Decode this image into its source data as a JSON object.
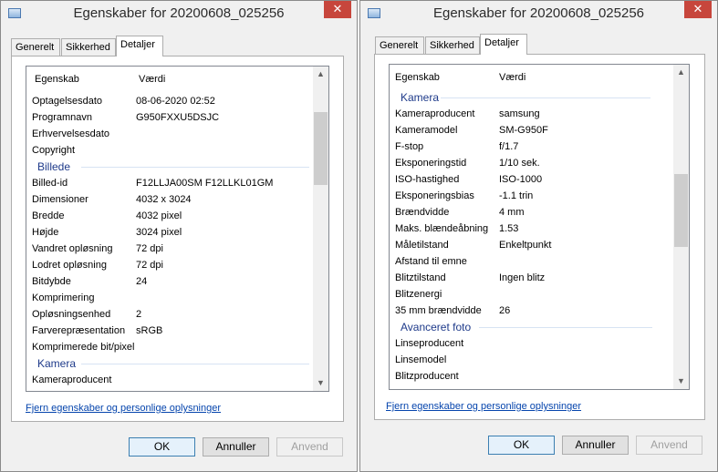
{
  "left_window": {
    "title": "Egenskaber for 20200608_025256",
    "close_glyph": "✕",
    "tabs": [
      {
        "label": "Generelt"
      },
      {
        "label": "Sikkerhed"
      },
      {
        "label": "Detaljer"
      }
    ],
    "columns": {
      "property": "Egenskab",
      "value": "Værdi"
    },
    "rows_before_group1": [
      {
        "k": "Optagelsesdato",
        "v": "08-06-2020 02:52"
      },
      {
        "k": "Programnavn",
        "v": "G950FXXU5DSJC"
      },
      {
        "k": "Erhvervelsesdato",
        "v": ""
      },
      {
        "k": "Copyright",
        "v": ""
      }
    ],
    "group1": "Billede",
    "group1_rows": [
      {
        "k": "Billed-id",
        "v": "F12LLJA00SM F12LLKL01GM"
      },
      {
        "k": "Dimensioner",
        "v": "4032 x 3024"
      },
      {
        "k": "Bredde",
        "v": "4032 pixel"
      },
      {
        "k": "Højde",
        "v": "3024 pixel"
      },
      {
        "k": "Vandret opløsning",
        "v": "72 dpi"
      },
      {
        "k": "Lodret opløsning",
        "v": "72 dpi"
      },
      {
        "k": "Bitdybde",
        "v": "24"
      },
      {
        "k": "Komprimering",
        "v": ""
      },
      {
        "k": "Opløsningsenhed",
        "v": "2"
      },
      {
        "k": "Farverepræsentation",
        "v": "sRGB"
      },
      {
        "k": "Komprimerede bit/pixel",
        "v": ""
      }
    ],
    "group2": "Kamera",
    "group2_rows": [
      {
        "k": "Kameraproducent",
        "v": ""
      }
    ],
    "link": "Fjern egenskaber og personlige oplysninger",
    "buttons": {
      "ok": "OK",
      "cancel": "Annuller",
      "apply": "Anvend"
    }
  },
  "right_window": {
    "title": "Egenskaber for 20200608_025256",
    "close_glyph": "✕",
    "tabs": [
      {
        "label": "Generelt"
      },
      {
        "label": "Sikkerhed"
      },
      {
        "label": "Detaljer"
      }
    ],
    "columns": {
      "property": "Egenskab",
      "value": "Værdi"
    },
    "group1": "Kamera",
    "group1_rows": [
      {
        "k": "Kameraproducent",
        "v": "samsung"
      },
      {
        "k": "Kameramodel",
        "v": "SM-G950F"
      },
      {
        "k": "F-stop",
        "v": "f/1.7"
      },
      {
        "k": "Eksponeringstid",
        "v": "1/10 sek."
      },
      {
        "k": "ISO-hastighed",
        "v": "ISO-1000"
      },
      {
        "k": "Eksponeringsbias",
        "v": "-1.1 trin"
      },
      {
        "k": "Brændvidde",
        "v": "4 mm"
      },
      {
        "k": "Maks. blændeåbning",
        "v": "1.53"
      },
      {
        "k": "Måletilstand",
        "v": "Enkeltpunkt"
      },
      {
        "k": "Afstand til emne",
        "v": ""
      },
      {
        "k": "Blitztilstand",
        "v": "Ingen blitz"
      },
      {
        "k": "Blitzenergi",
        "v": ""
      },
      {
        "k": "35 mm brændvidde",
        "v": "26"
      }
    ],
    "group2": "Avanceret foto",
    "group2_rows": [
      {
        "k": "Linseproducent",
        "v": ""
      },
      {
        "k": "Linsemodel",
        "v": ""
      },
      {
        "k": "Blitzproducent",
        "v": ""
      }
    ],
    "link": "Fjern egenskaber og personlige oplysninger",
    "buttons": {
      "ok": "OK",
      "cancel": "Annuller",
      "apply": "Anvend"
    }
  }
}
